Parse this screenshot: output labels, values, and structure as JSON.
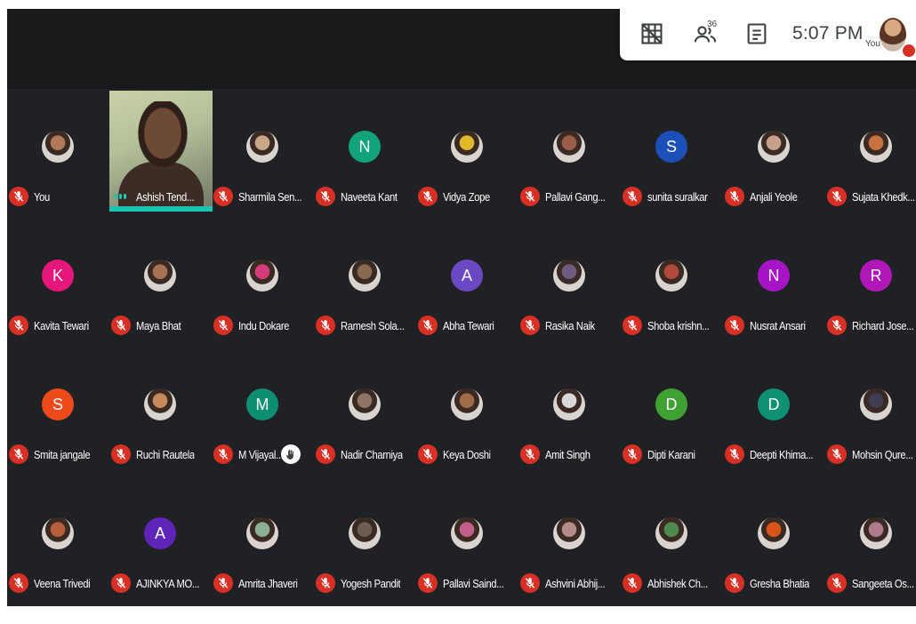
{
  "toolbar": {
    "participant_count": "36",
    "time": "5:07 PM",
    "self_label": "You"
  },
  "colors": {
    "stage_bg": "#202124",
    "muted_red": "#d93025",
    "speaking_teal": "#1ac4b3"
  },
  "participants": [
    {
      "name": "You",
      "type": "photo",
      "tone": "#b07a5a"
    },
    {
      "name": "Ashish Tend...",
      "type": "video",
      "speaking": true
    },
    {
      "name": "Sharmila Sen...",
      "type": "photo",
      "tone": "#c9a88a"
    },
    {
      "name": "Naveeta Kant",
      "type": "letter",
      "letter": "N",
      "color": "#12a37b"
    },
    {
      "name": "Vidya Zope",
      "type": "photo",
      "tone": "#e0b92a"
    },
    {
      "name": "Pallavi Gang...",
      "type": "photo",
      "tone": "#9a5e4a"
    },
    {
      "name": "sunita suralkar",
      "type": "letter",
      "letter": "S",
      "color": "#1d4fb8"
    },
    {
      "name": "Anjali Yeole",
      "type": "photo",
      "tone": "#c79f8d"
    },
    {
      "name": "Sujata Khedk...",
      "type": "photo",
      "tone": "#c9713f"
    },
    {
      "name": "Kavita Tewari",
      "type": "letter",
      "letter": "K",
      "color": "#e5177b"
    },
    {
      "name": "Maya Bhat",
      "type": "photo",
      "tone": "#a77254"
    },
    {
      "name": "Indu Dokare",
      "type": "photo",
      "tone": "#d63c7a"
    },
    {
      "name": "Ramesh Sola...",
      "type": "photo",
      "tone": "#8a6a4f"
    },
    {
      "name": "Abha Tewari",
      "type": "letter",
      "letter": "A",
      "color": "#6c49c4"
    },
    {
      "name": "Rasika Naik",
      "type": "photo",
      "tone": "#6f5b7d"
    },
    {
      "name": "Shoba krishn...",
      "type": "photo",
      "tone": "#b24a3c"
    },
    {
      "name": "Nusrat Ansari",
      "type": "letter",
      "letter": "N",
      "color": "#a615c5"
    },
    {
      "name": "Richard Jose...",
      "type": "letter",
      "letter": "R",
      "color": "#b017b8"
    },
    {
      "name": "Smita jangale",
      "type": "letter",
      "letter": "S",
      "color": "#ef4a1c"
    },
    {
      "name": "Ruchi Rautela",
      "type": "photo",
      "tone": "#c78a5c"
    },
    {
      "name": "M Vijayal...",
      "type": "letter",
      "letter": "M",
      "color": "#0f8f72",
      "hand": true
    },
    {
      "name": "Nadir Charniya",
      "type": "photo",
      "tone": "#8d7464"
    },
    {
      "name": "Keya Doshi",
      "type": "photo",
      "tone": "#a16a48"
    },
    {
      "name": "Amit Singh",
      "type": "photo",
      "tone": "#d8d8d8"
    },
    {
      "name": "Dipti Karani",
      "type": "letter",
      "letter": "D",
      "color": "#3fa132"
    },
    {
      "name": "Deepti Khima...",
      "type": "letter",
      "letter": "D",
      "color": "#0e9173"
    },
    {
      "name": "Mohsin Qure...",
      "type": "photo",
      "tone": "#3f3e55"
    },
    {
      "name": "Veena Trivedi",
      "type": "photo",
      "tone": "#b85e3b"
    },
    {
      "name": "AJINKYA MO...",
      "type": "letter",
      "letter": "A",
      "color": "#5e26b8"
    },
    {
      "name": "Amrita Jhaveri",
      "type": "photo",
      "tone": "#8cae94"
    },
    {
      "name": "Yogesh Pandit",
      "type": "photo",
      "tone": "#6e5d52"
    },
    {
      "name": "Pallavi Saind...",
      "type": "photo",
      "tone": "#c45f8a"
    },
    {
      "name": "Ashvini Abhij...",
      "type": "photo",
      "tone": "#b58b8b"
    },
    {
      "name": "Abhishek Ch...",
      "type": "photo",
      "tone": "#4f8a4f"
    },
    {
      "name": "Gresha Bhatia",
      "type": "photo",
      "tone": "#d9541b"
    },
    {
      "name": "Sangeeta Os...",
      "type": "photo",
      "tone": "#b07a8f"
    }
  ]
}
